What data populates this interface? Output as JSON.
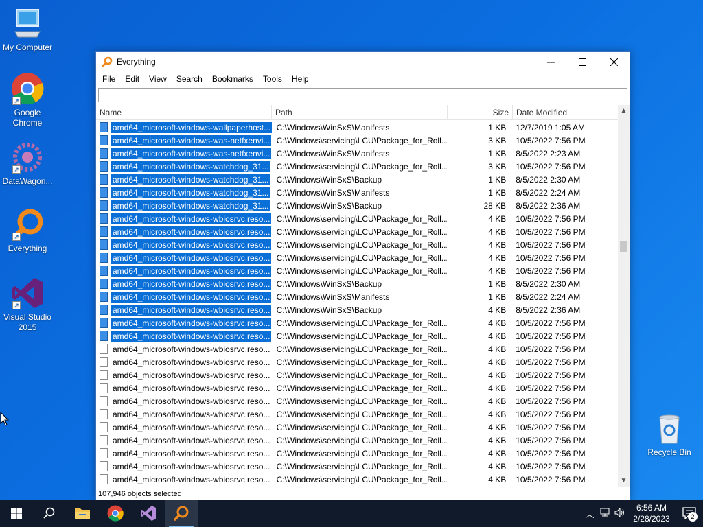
{
  "desktop": {
    "icons": [
      {
        "label": "My Computer",
        "icon": "computer-icon"
      },
      {
        "label": "Google Chrome",
        "icon": "chrome-icon"
      },
      {
        "label": "DataWagon...",
        "icon": "datawagon-icon"
      },
      {
        "label": "Everything",
        "icon": "everything-icon"
      },
      {
        "label": "Visual Studio 2015",
        "icon": "visual-studio-icon"
      },
      {
        "label": "Recycle Bin",
        "icon": "recycle-bin-icon"
      }
    ]
  },
  "window": {
    "title": "Everything",
    "menu": [
      "File",
      "Edit",
      "View",
      "Search",
      "Bookmarks",
      "Tools",
      "Help"
    ],
    "search_value": "",
    "columns": {
      "name": "Name",
      "path": "Path",
      "size": "Size",
      "date": "Date Modified"
    },
    "rows": [
      {
        "name": "amd64_microsoft-windows-wallpaperhost...",
        "path": "C:\\Windows\\WinSxS\\Manifests",
        "size": "1 KB",
        "date": "12/7/2019 1:05 AM",
        "selected": true
      },
      {
        "name": "amd64_microsoft-windows-was-netfxenvi...",
        "path": "C:\\Windows\\servicing\\LCU\\Package_for_Roll...",
        "size": "3 KB",
        "date": "10/5/2022 7:56 PM",
        "selected": true
      },
      {
        "name": "amd64_microsoft-windows-was-netfxenvi...",
        "path": "C:\\Windows\\WinSxS\\Manifests",
        "size": "1 KB",
        "date": "8/5/2022 2:23 AM",
        "selected": true
      },
      {
        "name": "amd64_microsoft-windows-watchdog_31...",
        "path": "C:\\Windows\\servicing\\LCU\\Package_for_Roll...",
        "size": "3 KB",
        "date": "10/5/2022 7:56 PM",
        "selected": true
      },
      {
        "name": "amd64_microsoft-windows-watchdog_31...",
        "path": "C:\\Windows\\WinSxS\\Backup",
        "size": "1 KB",
        "date": "8/5/2022 2:30 AM",
        "selected": true
      },
      {
        "name": "amd64_microsoft-windows-watchdog_31...",
        "path": "C:\\Windows\\WinSxS\\Manifests",
        "size": "1 KB",
        "date": "8/5/2022 2:24 AM",
        "selected": true
      },
      {
        "name": "amd64_microsoft-windows-watchdog_31...",
        "path": "C:\\Windows\\WinSxS\\Backup",
        "size": "28 KB",
        "date": "8/5/2022 2:36 AM",
        "selected": true
      },
      {
        "name": "amd64_microsoft-windows-wbiosrvc.reso...",
        "path": "C:\\Windows\\servicing\\LCU\\Package_for_Roll...",
        "size": "4 KB",
        "date": "10/5/2022 7:56 PM",
        "selected": true
      },
      {
        "name": "amd64_microsoft-windows-wbiosrvc.reso...",
        "path": "C:\\Windows\\servicing\\LCU\\Package_for_Roll...",
        "size": "4 KB",
        "date": "10/5/2022 7:56 PM",
        "selected": true
      },
      {
        "name": "amd64_microsoft-windows-wbiosrvc.reso...",
        "path": "C:\\Windows\\servicing\\LCU\\Package_for_Roll...",
        "size": "4 KB",
        "date": "10/5/2022 7:56 PM",
        "selected": true
      },
      {
        "name": "amd64_microsoft-windows-wbiosrvc.reso...",
        "path": "C:\\Windows\\servicing\\LCU\\Package_for_Roll...",
        "size": "4 KB",
        "date": "10/5/2022 7:56 PM",
        "selected": true
      },
      {
        "name": "amd64_microsoft-windows-wbiosrvc.reso...",
        "path": "C:\\Windows\\servicing\\LCU\\Package_for_Roll...",
        "size": "4 KB",
        "date": "10/5/2022 7:56 PM",
        "selected": true
      },
      {
        "name": "amd64_microsoft-windows-wbiosrvc.reso...",
        "path": "C:\\Windows\\WinSxS\\Backup",
        "size": "1 KB",
        "date": "8/5/2022 2:30 AM",
        "selected": true
      },
      {
        "name": "amd64_microsoft-windows-wbiosrvc.reso...",
        "path": "C:\\Windows\\WinSxS\\Manifests",
        "size": "1 KB",
        "date": "8/5/2022 2:24 AM",
        "selected": true
      },
      {
        "name": "amd64_microsoft-windows-wbiosrvc.reso...",
        "path": "C:\\Windows\\WinSxS\\Backup",
        "size": "4 KB",
        "date": "8/5/2022 2:36 AM",
        "selected": true
      },
      {
        "name": "amd64_microsoft-windows-wbiosrvc.reso...",
        "path": "C:\\Windows\\servicing\\LCU\\Package_for_Roll...",
        "size": "4 KB",
        "date": "10/5/2022 7:56 PM",
        "selected": true
      },
      {
        "name": "amd64_microsoft-windows-wbiosrvc.reso...",
        "path": "C:\\Windows\\servicing\\LCU\\Package_for_Roll...",
        "size": "4 KB",
        "date": "10/5/2022 7:56 PM",
        "selected": true
      },
      {
        "name": "amd64_microsoft-windows-wbiosrvc.reso...",
        "path": "C:\\Windows\\servicing\\LCU\\Package_for_Roll...",
        "size": "4 KB",
        "date": "10/5/2022 7:56 PM",
        "selected": false
      },
      {
        "name": "amd64_microsoft-windows-wbiosrvc.reso...",
        "path": "C:\\Windows\\servicing\\LCU\\Package_for_Roll...",
        "size": "4 KB",
        "date": "10/5/2022 7:56 PM",
        "selected": false
      },
      {
        "name": "amd64_microsoft-windows-wbiosrvc.reso...",
        "path": "C:\\Windows\\servicing\\LCU\\Package_for_Roll...",
        "size": "4 KB",
        "date": "10/5/2022 7:56 PM",
        "selected": false
      },
      {
        "name": "amd64_microsoft-windows-wbiosrvc.reso...",
        "path": "C:\\Windows\\servicing\\LCU\\Package_for_Roll...",
        "size": "4 KB",
        "date": "10/5/2022 7:56 PM",
        "selected": false
      },
      {
        "name": "amd64_microsoft-windows-wbiosrvc.reso...",
        "path": "C:\\Windows\\servicing\\LCU\\Package_for_Roll...",
        "size": "4 KB",
        "date": "10/5/2022 7:56 PM",
        "selected": false
      },
      {
        "name": "amd64_microsoft-windows-wbiosrvc.reso...",
        "path": "C:\\Windows\\servicing\\LCU\\Package_for_Roll...",
        "size": "4 KB",
        "date": "10/5/2022 7:56 PM",
        "selected": false
      },
      {
        "name": "amd64_microsoft-windows-wbiosrvc.reso...",
        "path": "C:\\Windows\\servicing\\LCU\\Package_for_Roll...",
        "size": "4 KB",
        "date": "10/5/2022 7:56 PM",
        "selected": false
      },
      {
        "name": "amd64_microsoft-windows-wbiosrvc.reso...",
        "path": "C:\\Windows\\servicing\\LCU\\Package_for_Roll...",
        "size": "4 KB",
        "date": "10/5/2022 7:56 PM",
        "selected": false
      },
      {
        "name": "amd64_microsoft-windows-wbiosrvc.reso...",
        "path": "C:\\Windows\\servicing\\LCU\\Package_for_Roll...",
        "size": "4 KB",
        "date": "10/5/2022 7:56 PM",
        "selected": false
      },
      {
        "name": "amd64_microsoft-windows-wbiosrvc.reso...",
        "path": "C:\\Windows\\servicing\\LCU\\Package_for_Roll...",
        "size": "4 KB",
        "date": "10/5/2022 7:56 PM",
        "selected": false
      },
      {
        "name": "amd64_microsoft-windows-wbiosrvc.reso...",
        "path": "C:\\Windows\\servicing\\LCU\\Package_for_Roll...",
        "size": "4 KB",
        "date": "10/5/2022 7:56 PM",
        "selected": false
      }
    ],
    "status": "107,946 objects selected"
  },
  "taskbar": {
    "apps": [
      "start-icon",
      "search-icon",
      "file-explorer-icon",
      "chrome-icon",
      "visual-studio-icon",
      "everything-icon"
    ],
    "clock_time": "6:56 AM",
    "clock_date": "2/28/2023",
    "notification_count": "2"
  },
  "colors": {
    "selection": "#0a6fd6",
    "desktop": "#0b6ee0",
    "taskbar": "#101a2a"
  }
}
